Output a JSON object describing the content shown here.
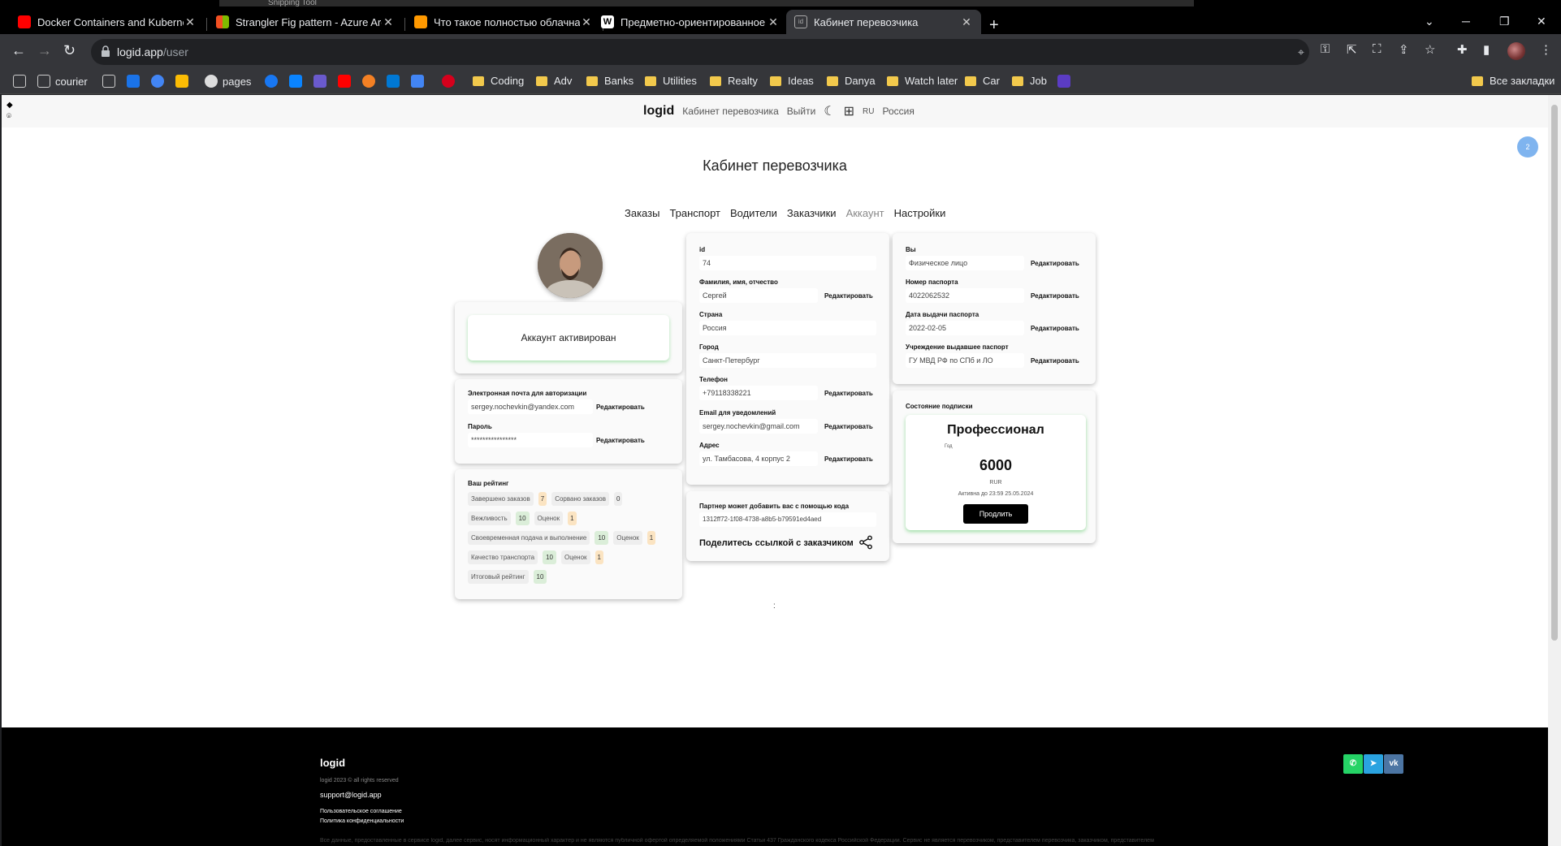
{
  "browser": {
    "snip_title": "Snipping Tool",
    "tabs": [
      {
        "title": "Docker Containers and Kuberne",
        "fav_color": "#ff0000"
      },
      {
        "title": "Strangler Fig pattern - Azure Arc",
        "fav_color": "#f25022"
      },
      {
        "title": "Что такое полностью облачная",
        "fav_color": "#ff9900"
      },
      {
        "title": "Предметно-ориентированное",
        "fav_color": "#ffffff"
      },
      {
        "title": "Кабинет перевозчика",
        "fav_color": "#888888"
      }
    ],
    "url_host": "logid.app",
    "url_path": "/user",
    "bookmarks": {
      "courier": "courier",
      "pages": "pages",
      "folders": [
        "Coding",
        "Adv",
        "Banks",
        "Utilities",
        "Realty",
        "Ideas",
        "Danya",
        "Watch later",
        "Car",
        "Job"
      ],
      "all": "Все закладки"
    }
  },
  "header": {
    "logo": "logid",
    "cabinet": "Кабинет перевозчика",
    "logout": "Выйти",
    "lang": "RU",
    "country": "Россия",
    "notif_count": "2"
  },
  "page_title": "Кабинет перевозчика",
  "nav": [
    "Заказы",
    "Транспорт",
    "Водители",
    "Заказчики",
    "Аккаунт",
    "Настройки"
  ],
  "account_status": "Аккаунт активирован",
  "auth": {
    "email_label": "Электронная почта для авторизации",
    "email": "sergey.nochevkin@yandex.com",
    "password_label": "Пароль",
    "password": "****************",
    "edit": "Редактировать"
  },
  "rating": {
    "title": "Ваш рейтинг",
    "completed_label": "Завершено заказов",
    "completed": "7",
    "cancelled_label": "Сорвано заказов",
    "cancelled": "0",
    "politeness_label": "Вежливость",
    "politeness": "10",
    "politeness_votes_label": "Оценок",
    "politeness_votes": "1",
    "timely_label": "Своевременная подача и выполнение",
    "timely": "10",
    "timely_votes_label": "Оценок",
    "timely_votes": "1",
    "transport_label": "Качество транспорта",
    "transport": "10",
    "transport_votes_label": "Оценок",
    "transport_votes": "1",
    "total_label": "Итоговый рейтинг",
    "total": "10"
  },
  "profile": {
    "id_label": "id",
    "id": "74",
    "name_label": "Фамилия, имя, отчество",
    "name": "Сергей",
    "country_label": "Страна",
    "country": "Россия",
    "city_label": "Город",
    "city": "Санкт-Петербург",
    "phone_label": "Телефон",
    "phone": "+79118338221",
    "notify_email_label": "Email для уведомлений",
    "notify_email": "sergey.nochevkin@gmail.com",
    "address_label": "Адрес",
    "address": "ул. Тамбасова, 4 корпус 2",
    "edit": "Редактировать"
  },
  "partner": {
    "label": "Партнер может добавить вас с помощью кода",
    "code": "1312ff72-1f08-4738-a8b5-b79591ed4aed",
    "share": "Поделитесь ссылкой с заказчиком"
  },
  "legal": {
    "you_label": "Вы",
    "you": "Физическое лицо",
    "passport_label": "Номер паспорта",
    "passport": "4022062532",
    "issue_date_label": "Дата выдачи паспорта",
    "issue_date": "2022-02-05",
    "issuer_label": "Учреждение выдавшее паспорт",
    "issuer": "ГУ МВД РФ по СПб и ЛО",
    "edit": "Редактировать"
  },
  "subscription": {
    "label": "Состояние подписки",
    "plan": "Профессионал",
    "period": "Год",
    "price": "6000",
    "currency": "RUR",
    "active_until": "Активна до 23:59 25.05.2024",
    "renew": "Продлить"
  },
  "footer": {
    "logo": "logid",
    "copyright": "logid 2023 © all rights reserved",
    "email": "support@logid.app",
    "agreement": "Пользовательское соглашение",
    "privacy": "Политика конфиденциальности",
    "disclaimer": "Все данные, предоставленные в сервисе logid, далее сервис, носят информационный характер и не являются публичной офертой определяемой положениями Статьи 437 Гражданского кодекса Российской Федерации. Сервис не является перевозчиком, представителем перевозчика, заказчиком, представителем"
  },
  "colors": {
    "accent_green": "#78d282",
    "badge_blue": "#7fb4ef",
    "whatsapp": "#25d366",
    "telegram": "#2aa3e0",
    "vk": "#4c75a3"
  }
}
